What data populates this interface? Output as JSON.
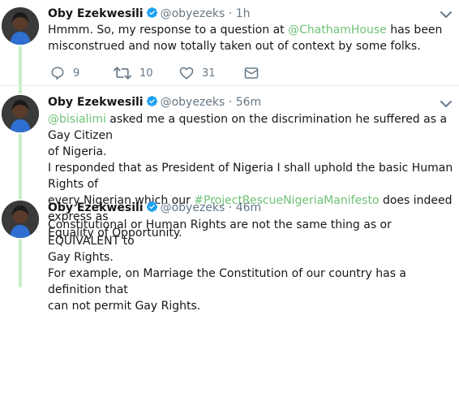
{
  "tweets": [
    {
      "display_name": "Oby Ezekwesili",
      "handle": "@obyezeks",
      "separator": "·",
      "time": "1h",
      "lines": [
        [
          {
            "t": "Hmmm. So, my response to a question at "
          },
          {
            "t": "@ChathamHouse",
            "link": true
          },
          {
            "t": " has been"
          }
        ],
        [
          {
            "t": "misconstrued and now totally taken out of context by some folks."
          }
        ]
      ],
      "actions": {
        "replies": "9",
        "retweets": "10",
        "likes": "31"
      }
    },
    {
      "display_name": "Oby Ezekwesili",
      "handle": "@obyezeks",
      "separator": "·",
      "time": "56m",
      "lines": [
        [
          {
            "t": "@bisialimi",
            "link": true
          },
          {
            "t": " asked me a question on the discrimination he suffered as a Gay Citizen"
          }
        ],
        [
          {
            "t": "of Nigeria."
          }
        ],
        [
          {
            "t": "I responded that as President of Nigeria I shall uphold the basic Human Rights of"
          }
        ],
        [
          {
            "t": "every Nigerian which our "
          },
          {
            "t": "#ProjectRescueNigeriaManifesto",
            "link": true
          },
          {
            "t": " does indeed express as"
          }
        ],
        [
          {
            "t": "Equality of Opportunity."
          }
        ]
      ]
    },
    {
      "display_name": "Oby Ezekwesili",
      "handle": "@obyezeks",
      "separator": "·",
      "time": "46m",
      "lines": [
        [
          {
            "t": "Constitutional or Human Rights are not the same thing as or EQUIVALENT to"
          }
        ],
        [
          {
            "t": "Gay Rights."
          }
        ],
        [
          {
            "t": "For example, on Marriage the Constitution of our country has a definition that"
          }
        ],
        [
          {
            "t": "can not permit Gay Rights."
          }
        ]
      ]
    }
  ],
  "colors": {
    "link": "#6fc276",
    "thread_line": "#c9eec8",
    "verified": "#1da1f2",
    "muted": "#657786"
  },
  "icons": {
    "reply": "reply-icon",
    "retweet": "retweet-icon",
    "like": "heart-icon",
    "dm": "envelope-icon",
    "more": "chevron-down-icon",
    "verified": "verified-badge-icon"
  }
}
